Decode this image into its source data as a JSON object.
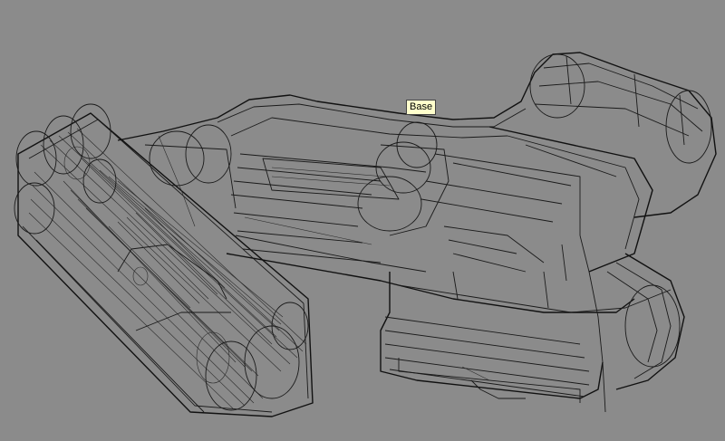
{
  "viewport": {
    "background_color": "#8b8b8b",
    "wire_color": "#1a1a1a"
  },
  "tooltip": {
    "label": "Base",
    "background_color": "#ffffcc"
  }
}
